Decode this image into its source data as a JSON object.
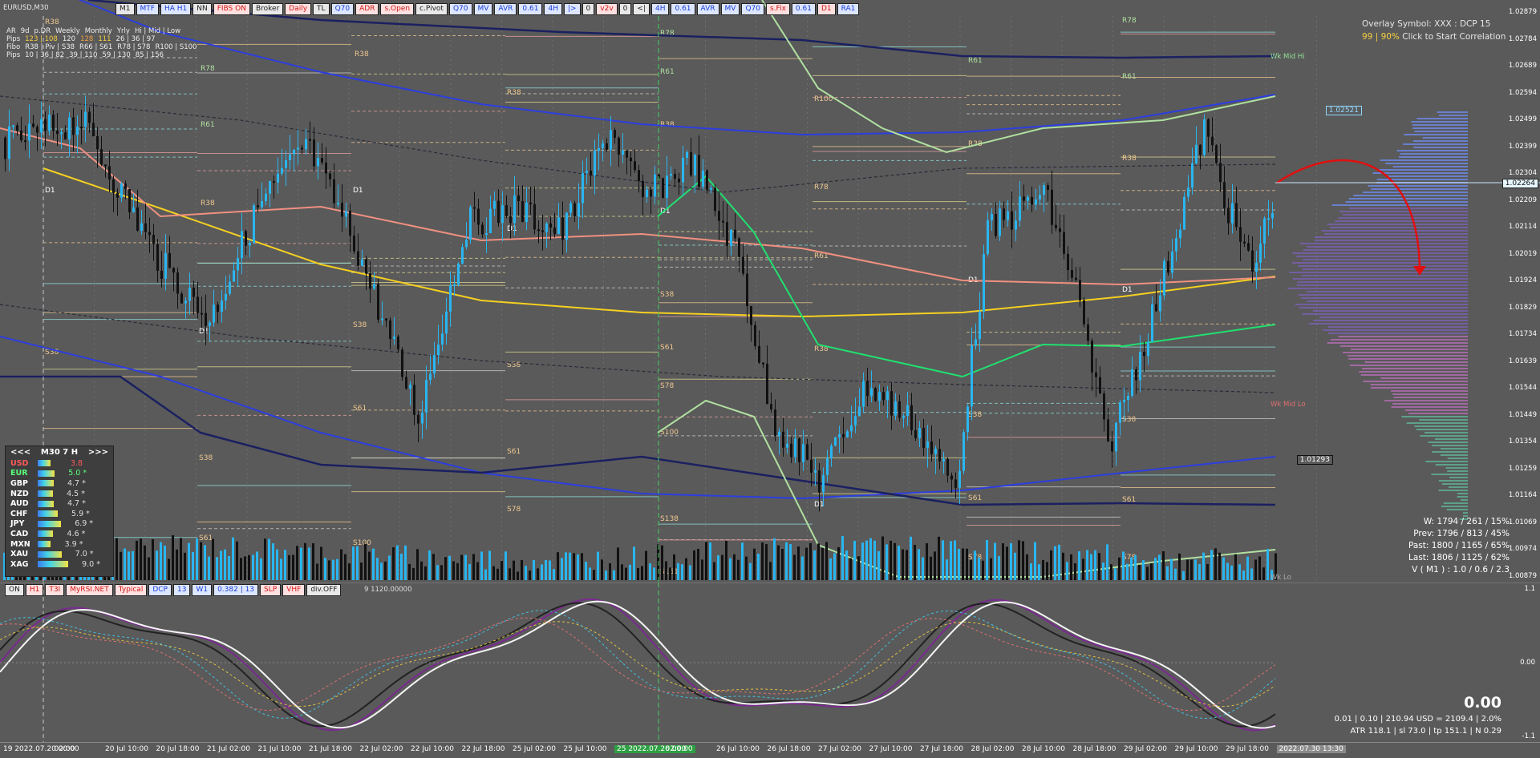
{
  "window": {
    "symbol_title": "EURUSD,M30"
  },
  "toolbar": {
    "buttons": [
      "M1",
      "MTF",
      "HA H1",
      "NN",
      "FIBS ON",
      "Broker",
      "Daily",
      "TL",
      "Q70",
      "ADR",
      "s.Open",
      "c.Pivot",
      "Q70",
      "MV",
      "AVR",
      "0.61",
      "4H",
      "|>",
      "0",
      "v2v",
      "0",
      "<|",
      "4H",
      "0.61",
      "AVR",
      "MV",
      "Q70",
      "s.Fix",
      "0.61",
      "D1",
      "RA1"
    ]
  },
  "pip_info": {
    "header": [
      "AR",
      "9d",
      "p.DR",
      "Weekly",
      "Monthly",
      "Yrly",
      "Hi | Mid | Low"
    ],
    "pips_row": [
      "Pips",
      "123 | 108",
      "120",
      "128",
      "111",
      "26 | 36 | 97"
    ],
    "fibo_header": [
      "Fibo",
      "R38 | Piv | S38",
      "R66 | S61",
      "R78 | S78",
      "R100 | S100"
    ],
    "fibo_pips": [
      "Pips",
      "10 | 36 | 82",
      "39 | 110",
      "59 | 130",
      "85 | 156"
    ]
  },
  "correlation": {
    "line1": "Overlay Symbol: XXX : DCP 15",
    "line2_a": "99 | 90%",
    "line2_b": "Click to Start Correlation"
  },
  "strength_panel": {
    "left": "<<<",
    "title": "M30  7  H",
    "right": ">>>",
    "rows": [
      {
        "name": "USD",
        "value": "3.8",
        "color": "#ff5a5a"
      },
      {
        "name": "EUR",
        "value": "5.0",
        "color": "#5aff7a"
      },
      {
        "name": "GBP",
        "value": "4.7",
        "color": "#ffffff"
      },
      {
        "name": "NZD",
        "value": "4.5",
        "color": "#ffffff"
      },
      {
        "name": "AUD",
        "value": "4.7",
        "color": "#ffffff"
      },
      {
        "name": "CHF",
        "value": "5.9",
        "color": "#ffffff"
      },
      {
        "name": "JPY",
        "value": "6.9",
        "color": "#ffffff"
      },
      {
        "name": "CAD",
        "value": "4.6",
        "color": "#ffffff"
      },
      {
        "name": "MXN",
        "value": "3.9",
        "color": "#ffffff"
      },
      {
        "name": "XAU",
        "value": "7.0",
        "color": "#ffffff"
      },
      {
        "name": "XAG",
        "value": "9.0",
        "color": "#ffffff"
      }
    ]
  },
  "price_axis": [
    "1.02879",
    "1.02784",
    "1.02689",
    "1.02594",
    "1.02499",
    "1.02399",
    "1.02304",
    "1.02209",
    "1.02114",
    "1.02019",
    "1.01924",
    "1.01829",
    "1.01734",
    "1.01639",
    "1.01544",
    "1.01449",
    "1.01354",
    "1.01259",
    "1.01164",
    "1.01069",
    "1.00974",
    "1.00879"
  ],
  "current_price": "1.02264",
  "box_price_hi": "1.02521",
  "box_price_lo": "1.01293",
  "sub_axis": [
    "1.1",
    "0.00",
    "-1.1"
  ],
  "time_axis": [
    "19 2022.07.20 00:00",
    "02:00",
    "20 Jul 10:00",
    "20 Jul 18:00",
    "21 Jul 02:00",
    "21 Jul 10:00",
    "21 Jul 18:00",
    "22 Jul 02:00",
    "22 Jul 10:00",
    "22 Jul 18:00",
    "25 Jul 02:00",
    "25 Jul 10:00",
    "25 2022.07.26 00:00",
    "02:00",
    "26 Jul 10:00",
    "26 Jul 18:00",
    "27 Jul 02:00",
    "27 Jul 10:00",
    "27 Jul 18:00",
    "28 Jul 02:00",
    "28 Jul 10:00",
    "28 Jul 18:00",
    "29 Jul 02:00",
    "29 Jul 10:00",
    "29 Jul 18:00",
    "2022.07.30 13:30"
  ],
  "stats": {
    "w": "W: 1794 / 261 / 15%",
    "prev": "Prev: 1796 / 813 / 45%",
    "past": "Past: 1800 / 1165 / 65%",
    "last": "Last: 1806 / 1125 / 62%",
    "v": "V ( M1 ) : 1.0 / 0.6 / 2.3"
  },
  "bottom_stats": {
    "big": "0.00",
    "line1": "0.01  |  0.10  |  210.94 USD = 2109.4  |  2.0%",
    "line2": "ATR 118.1  |  sl 73.0  |  tp 151.1  |  N 0.29"
  },
  "sub_toolbar": [
    "ON",
    "H1",
    "T3I",
    "MyRSI.NET",
    "Typical",
    "DCP",
    "13",
    "W1",
    "0.382 | 13",
    "SLP",
    "VHF",
    "div.OFF"
  ],
  "sub_toolbar_tail": "9  1120.00000",
  "labels": {
    "wk_mid_hi": "Wk Mid Hi",
    "wk_mid_lo": "Wk Mid Lo",
    "wk_lo": "Wk Lo"
  },
  "level_labels": [
    "R78",
    "R61",
    "R38",
    "R100",
    "S38",
    "S61",
    "S78",
    "S100",
    "S138",
    "S161",
    "D1",
    "R38",
    "R61",
    "R78"
  ]
}
